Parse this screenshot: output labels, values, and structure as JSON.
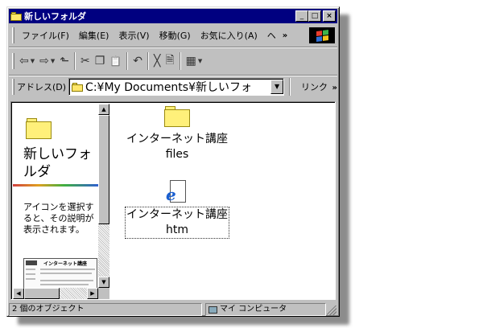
{
  "window": {
    "title": "新しいフォルダ"
  },
  "title_buttons": {
    "minimize": "_",
    "maximize": "□",
    "close": "×"
  },
  "menu": {
    "items": [
      "ファイル(F)",
      "編集(E)",
      "表示(V)",
      "移動(G)",
      "お気に入り(A)",
      "ヘ"
    ],
    "more": "»"
  },
  "toolbar": {
    "buttons": [
      {
        "name": "back",
        "glyph": "⇦",
        "dropdown": "▼"
      },
      {
        "name": "forward",
        "glyph": "⇨",
        "dropdown": "▼"
      },
      {
        "name": "up",
        "glyph": "⬑"
      },
      {
        "name": "cut",
        "glyph": "✂"
      },
      {
        "name": "copy",
        "glyph": "❐"
      },
      {
        "name": "paste",
        "glyph": "📋"
      },
      {
        "name": "undo",
        "glyph": "↶"
      },
      {
        "name": "delete",
        "glyph": "╳"
      },
      {
        "name": "properties",
        "glyph": "🗎"
      },
      {
        "name": "views",
        "glyph": "▦",
        "dropdown": "▼"
      }
    ]
  },
  "address": {
    "label": "アドレス(D)",
    "value": "C:¥My Documents¥新しいフォ",
    "dropdown": "▼",
    "links_label": "リンク",
    "links_more": "»"
  },
  "left_pane": {
    "title": "新しいフォルダ",
    "description": "アイコンを選択すると、その説明が表示されます。",
    "thumbnail_caption": "インターネット講座"
  },
  "files": [
    {
      "name_line1": "インターネット講座",
      "name_line2": "files",
      "type": "folder"
    },
    {
      "name_line1": "インターネット講座",
      "name_line2": "htm",
      "type": "html"
    }
  ],
  "statusbar": {
    "count": "2 個のオブジェクト",
    "location": "マイ コンピュータ"
  },
  "colors": {
    "titlebar": "#000080",
    "chrome": "#c0c0c0",
    "folder": "#fff07a",
    "ie_blue": "#1a5fd0"
  }
}
